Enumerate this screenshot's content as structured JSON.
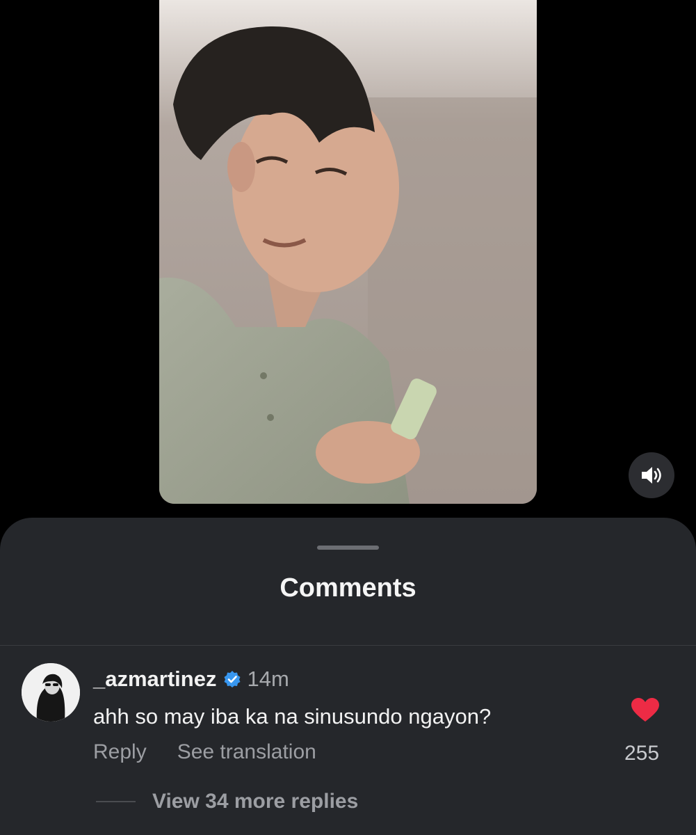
{
  "sheet": {
    "title": "Comments"
  },
  "comment": {
    "username": "_azmartinez",
    "verified": true,
    "time": "14m",
    "text": "ahh so may iba ka na sinusundo ngayon?",
    "reply_label": "Reply",
    "translate_label": "See translation",
    "likes": "255",
    "liked": true,
    "view_replies_label": "View 34 more replies"
  },
  "icons": {
    "mute": "speaker-icon",
    "verified": "verified-badge-icon",
    "like": "heart-icon"
  },
  "colors": {
    "heart": "#ed2b45",
    "verified": "#3897f0",
    "sheet_bg": "#25272b"
  }
}
